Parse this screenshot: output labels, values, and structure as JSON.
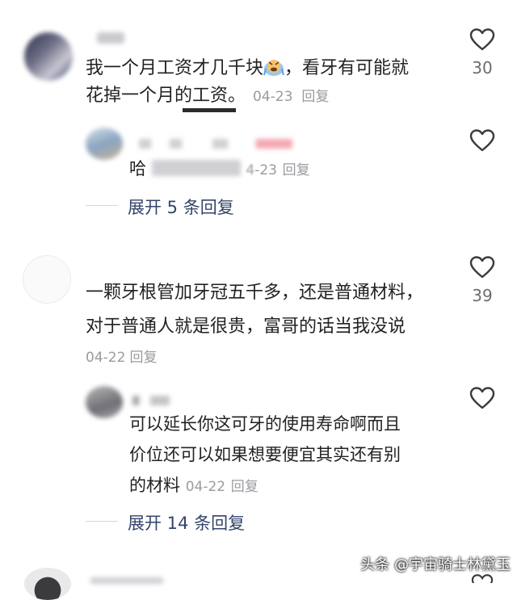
{
  "comments": [
    {
      "text_line1": "我一个月工资才几千块",
      "text_line1b": "，看牙有可能就",
      "text_line2": "花掉一个月的工资。",
      "date": "04-23",
      "reply_label": "回复",
      "likes": "30",
      "reply": {
        "text": "哈",
        "date": "-23",
        "date_prefix": "4",
        "reply_label": "回复"
      },
      "expand_label": "展开 5 条回复"
    },
    {
      "text_line1": "一颗牙根管加牙冠五千多，还是普通材料，",
      "text_line2": "对于普通人就是很贵，富哥的话当我没说",
      "date": "04-22",
      "reply_label": "回复",
      "likes": "39",
      "reply": {
        "text_line1": "可以延长你这可牙的使用寿命啊而且",
        "text_line2": "价位还可以如果想要便宜其实还有别",
        "text_line3": "的材料",
        "date": "04-22",
        "reply_label": "回复"
      },
      "expand_label": "展开 14 条回复"
    }
  ],
  "watermark": "头条 @宇宙骑士林黛玉",
  "icons": {
    "like": "heart-outline-icon",
    "emoji": "crying-face-emoji"
  },
  "colors": {
    "text": "#222222",
    "meta": "#9a9aa0",
    "expand": "#34446b",
    "icon": "#3a3a40"
  }
}
